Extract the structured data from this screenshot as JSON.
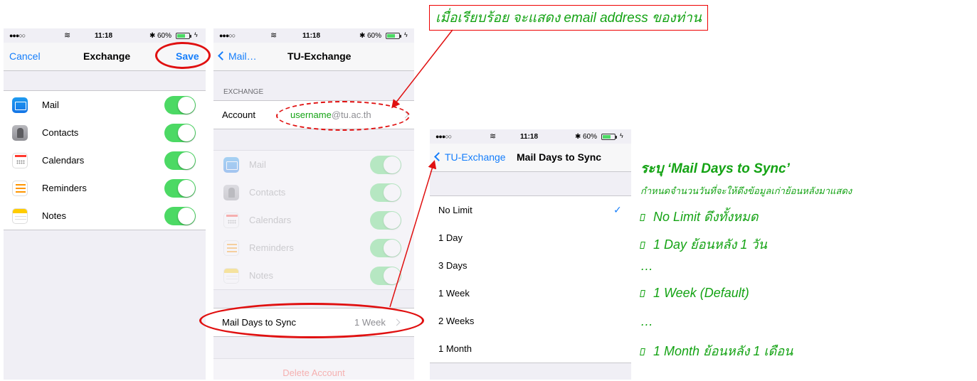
{
  "status": {
    "time": "11:18",
    "battery": "60%",
    "battery_level": 0.6
  },
  "screen1": {
    "nav": {
      "cancel": "Cancel",
      "title": "Exchange",
      "save": "Save"
    },
    "toggles": [
      {
        "label": "Mail",
        "icon": "mail-icon",
        "on": true
      },
      {
        "label": "Contacts",
        "icon": "contacts-icon",
        "on": true
      },
      {
        "label": "Calendars",
        "icon": "calendar-icon",
        "on": true
      },
      {
        "label": "Reminders",
        "icon": "reminders-icon",
        "on": true
      },
      {
        "label": "Notes",
        "icon": "notes-icon",
        "on": true
      }
    ]
  },
  "screen2": {
    "nav": {
      "back": "Mail…",
      "title": "TU-Exchange"
    },
    "section_header": "EXCHANGE",
    "account_label": "Account",
    "account_user": "username",
    "account_domain": "@tu.ac.th",
    "toggles": [
      {
        "label": "Mail"
      },
      {
        "label": "Contacts"
      },
      {
        "label": "Calendars"
      },
      {
        "label": "Reminders"
      },
      {
        "label": "Notes"
      }
    ],
    "mail_days_label": "Mail Days to Sync",
    "mail_days_value": "1 Week",
    "delete_account": "Delete Account"
  },
  "screen3": {
    "nav": {
      "back": "TU-Exchange",
      "title": "Mail Days to Sync"
    },
    "options": [
      "No Limit",
      "1 Day",
      "3 Days",
      "1 Week",
      "2 Weeks",
      "1 Month"
    ],
    "selected": "No Limit"
  },
  "annotations": {
    "top_box": "เมื่อเรียบร้อย จะแสดง email address ของท่าน",
    "title": "ระบุ ‘Mail Days to Sync’",
    "subtitle": "กำหนดจำนวนวันที่จะให้ดึงข้อมูลเก่าย้อนหลังมาแสดง",
    "items": [
      "No Limit ดึงทั้งหมด",
      "1 Day ย้อนหลัง 1 วัน",
      "…",
      "1 Week (Default)",
      "…",
      "1 Month ย้อนหลัง 1 เดือน"
    ]
  },
  "colors": {
    "ios_blue": "#157efb",
    "toggle_green": "#4cd964",
    "annot_green": "#14a314",
    "annot_red": "#e01010"
  }
}
